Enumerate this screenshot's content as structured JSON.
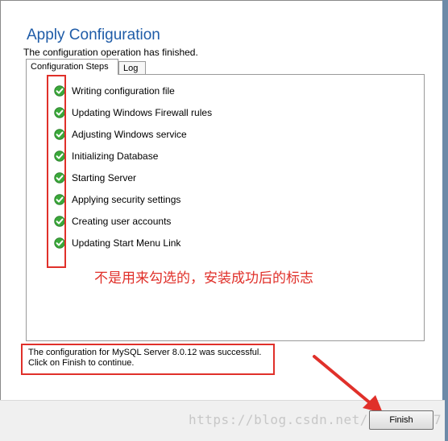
{
  "window": {
    "title": "Apply Configuration",
    "subtitle": "The configuration operation has finished."
  },
  "tabs": [
    {
      "label": "Configuration Steps",
      "active": true
    },
    {
      "label": "Log",
      "active": false
    }
  ],
  "steps": [
    {
      "label": "Writing configuration file",
      "status": "check-icon"
    },
    {
      "label": "Updating Windows Firewall rules",
      "status": "check-icon"
    },
    {
      "label": "Adjusting Windows service",
      "status": "check-icon"
    },
    {
      "label": "Initializing Database",
      "status": "check-icon"
    },
    {
      "label": "Starting Server",
      "status": "check-icon"
    },
    {
      "label": "Applying security settings",
      "status": "check-icon"
    },
    {
      "label": "Creating user accounts",
      "status": "check-icon"
    },
    {
      "label": "Updating Start Menu Link",
      "status": "check-icon"
    }
  ],
  "annotation": "不是用来勾选的，安装成功后的标志",
  "status_message": {
    "line1": "The configuration for MySQL Server 8.0.12 was successful.",
    "line2": "Click on Finish to continue."
  },
  "buttons": {
    "finish": "Finish"
  },
  "watermark": "https://blog.csdn.net/zhouis007",
  "colors": {
    "title": "#1f5ca8",
    "annotation": "#e0302a",
    "check": "#3aa83a"
  }
}
